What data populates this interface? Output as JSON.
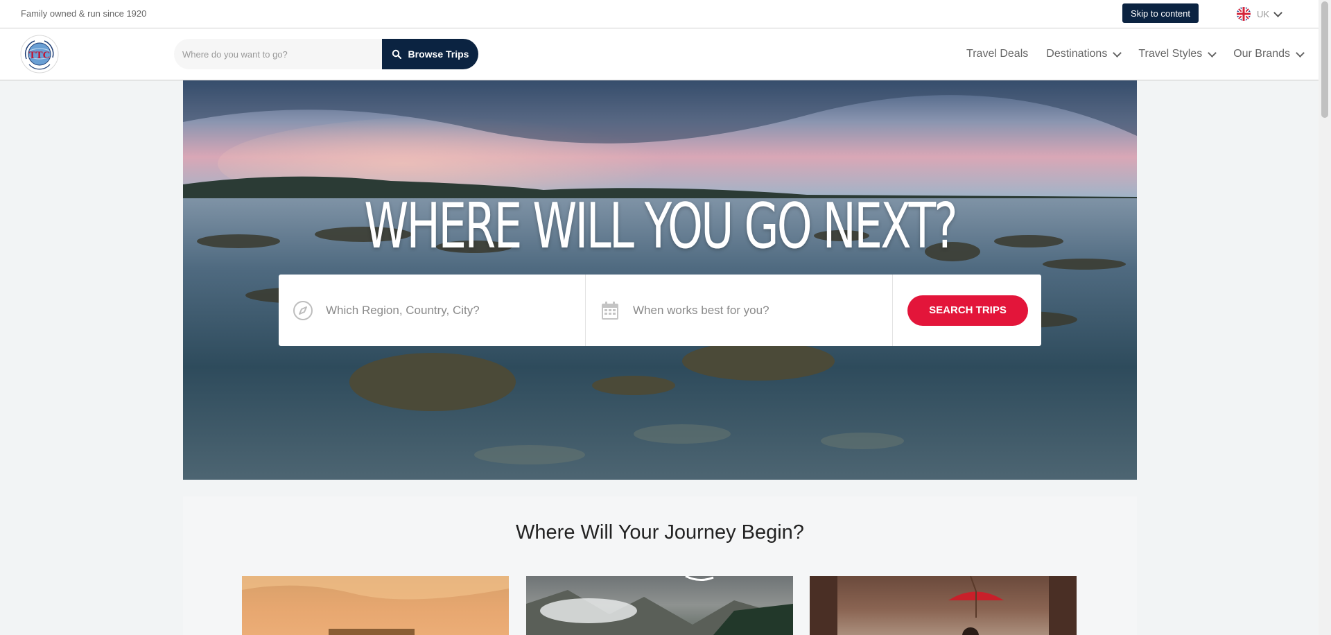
{
  "topbar": {
    "tagline": "Family owned & run since 1920",
    "skip_label": "Skip to content",
    "locale": {
      "label": "UK",
      "flag_icon": "uk-flag-icon"
    }
  },
  "header": {
    "logo_text": "THE TRAVEL CORPORATION",
    "logo_initials": "TTC",
    "search": {
      "placeholder": "Where do you want to go?",
      "value": ""
    },
    "browse_label": "Browse Trips",
    "nav": [
      {
        "label": "Travel Deals",
        "has_dropdown": false
      },
      {
        "label": "Destinations",
        "has_dropdown": true
      },
      {
        "label": "Travel Styles",
        "has_dropdown": true
      },
      {
        "label": "Our Brands",
        "has_dropdown": true
      }
    ]
  },
  "hero": {
    "title": "WHERE WILL YOU GO NEXT?",
    "destination": {
      "placeholder": "Which Region, Country, City?",
      "icon": "compass-icon"
    },
    "date": {
      "placeholder": "When works best for you?",
      "icon": "calendar-icon"
    },
    "search_label": "SEARCH TRIPS"
  },
  "journey": {
    "title": "Where Will Your Journey Begin?"
  },
  "colors": {
    "navy": "#0b2341",
    "red": "#e3153a",
    "page_bg": "#f2f4f5"
  }
}
